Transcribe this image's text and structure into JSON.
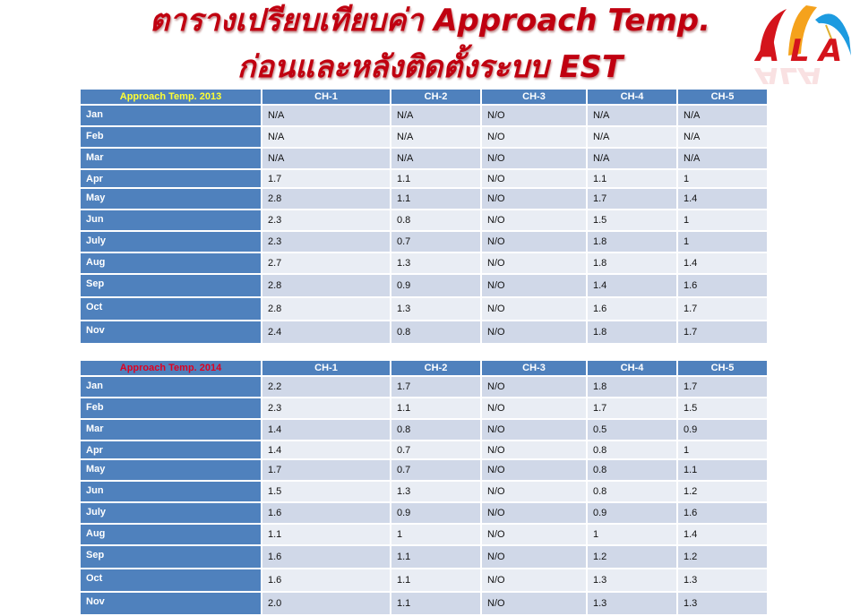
{
  "title": {
    "line1": "ตารางเปรียบเทียบค่า Approach Temp.",
    "line2": "ก่อนและหลังติดตั้งระบบ EST"
  },
  "logo": {
    "text": "ALA",
    "colors": {
      "red": "#d4141c",
      "orange": "#f5a21c",
      "blue": "#1d9be0"
    }
  },
  "colors": {
    "title_red": "#c00010",
    "header_blue": "#4f81bd",
    "row_dark": "#d0d8e8",
    "row_light": "#e9edf4",
    "corner_2013": "#ffff33",
    "corner_2014": "#e00020"
  },
  "tables": [
    {
      "corner_label": "Approach Temp. 2013",
      "columns": [
        "CH-1",
        "CH-2",
        "CH-3",
        "CH-4",
        "CH-5"
      ],
      "rows": [
        {
          "month": "Jan",
          "values": [
            "N/A",
            "N/A",
            "N/O",
            "N/A",
            "N/A"
          ]
        },
        {
          "month": "Feb",
          "values": [
            "N/A",
            "N/A",
            "N/O",
            "N/A",
            "N/A"
          ]
        },
        {
          "month": "Mar",
          "values": [
            "N/A",
            "N/A",
            "N/O",
            "N/A",
            "N/A"
          ]
        },
        {
          "month": "Apr",
          "values": [
            "1.7",
            "1.1",
            "N/O",
            "1.1",
            "1"
          ]
        },
        {
          "month": "May",
          "values": [
            "2.8",
            "1.1",
            "N/O",
            "1.7",
            "1.4"
          ]
        },
        {
          "month": "Jun",
          "values": [
            "2.3",
            "0.8",
            "N/O",
            "1.5",
            "1"
          ]
        },
        {
          "month": "July",
          "values": [
            "2.3",
            "0.7",
            "N/O",
            "1.8",
            "1"
          ]
        },
        {
          "month": "Aug",
          "values": [
            "2.7",
            "1.3",
            "N/O",
            "1.8",
            "1.4"
          ]
        },
        {
          "month": "Sep",
          "values": [
            "2.8",
            "0.9",
            "N/O",
            "1.4",
            "1.6"
          ]
        },
        {
          "month": "Oct",
          "values": [
            "2.8",
            "1.3",
            "N/O",
            "1.6",
            "1.7"
          ]
        },
        {
          "month": "Nov",
          "values": [
            "2.4",
            "0.8",
            "N/O",
            "1.8",
            "1.7"
          ]
        }
      ]
    },
    {
      "corner_label": "Approach Temp. 2014",
      "columns": [
        "CH-1",
        "CH-2",
        "CH-3",
        "CH-4",
        "CH-5"
      ],
      "rows": [
        {
          "month": "Jan",
          "values": [
            "2.2",
            "1.7",
            "N/O",
            "1.8",
            "1.7"
          ]
        },
        {
          "month": "Feb",
          "values": [
            "2.3",
            "1.1",
            "N/O",
            "1.7",
            "1.5"
          ]
        },
        {
          "month": "Mar",
          "values": [
            "1.4",
            "0.8",
            "N/O",
            "0.5",
            "0.9"
          ]
        },
        {
          "month": "Apr",
          "values": [
            "1.4",
            "0.7",
            "N/O",
            "0.8",
            "1"
          ]
        },
        {
          "month": "May",
          "values": [
            "1.7",
            "0.7",
            "N/O",
            "0.8",
            "1.1"
          ]
        },
        {
          "month": "Jun",
          "values": [
            "1.5",
            "1.3",
            "N/O",
            "0.8",
            "1.2"
          ]
        },
        {
          "month": "July",
          "values": [
            "1.6",
            "0.9",
            "N/O",
            "0.9",
            "1.6"
          ]
        },
        {
          "month": "Aug",
          "values": [
            "1.1",
            "1",
            "N/O",
            "1",
            "1.4"
          ]
        },
        {
          "month": "Sep",
          "values": [
            "1.6",
            "1.1",
            "N/O",
            "1.2",
            "1.2"
          ]
        },
        {
          "month": "Oct",
          "values": [
            "1.6",
            "1.1",
            "N/O",
            "1.3",
            "1.3"
          ]
        },
        {
          "month": "Nov",
          "values": [
            "2.0",
            "1.1",
            "N/O",
            "1.3",
            "1.3"
          ]
        }
      ]
    }
  ]
}
